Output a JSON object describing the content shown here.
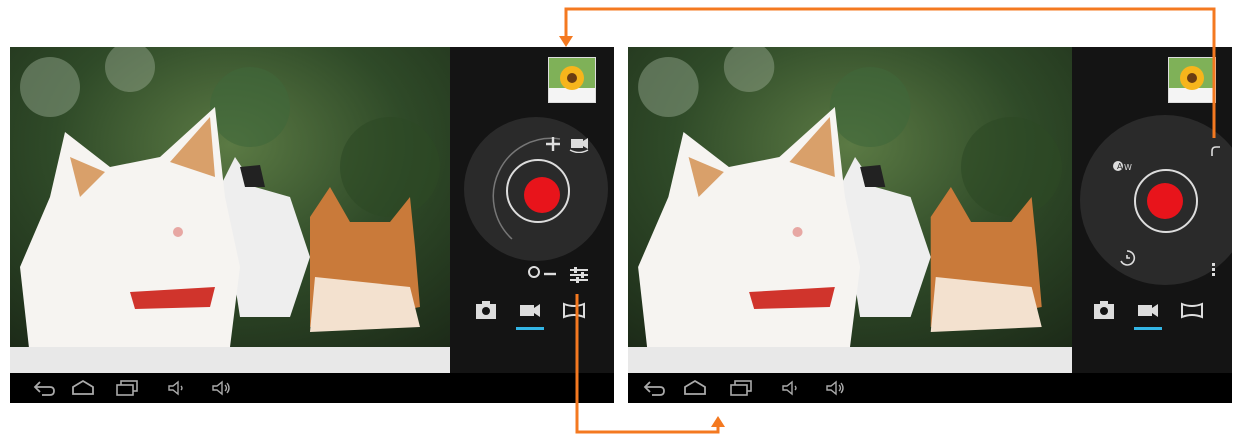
{
  "screens": [
    {
      "id": "left",
      "controls": [
        "zoom-in",
        "switch-camera",
        "zoom-out",
        "settings"
      ],
      "modes": [
        "camera",
        "video",
        "panorama"
      ],
      "active_mode": "video"
    },
    {
      "id": "right",
      "controls": [
        "white-balance-auto",
        "exposure-timer",
        "more-options"
      ],
      "modes": [
        "camera",
        "video",
        "panorama"
      ],
      "active_mode": "video"
    }
  ],
  "navigation": [
    "back",
    "home",
    "recent-apps",
    "volume-down",
    "volume-up"
  ],
  "colors": {
    "record_button": "#e8141b",
    "accent": "#33b5e5",
    "callout_arrows": "#f47920",
    "panel_bg": "#141414"
  }
}
